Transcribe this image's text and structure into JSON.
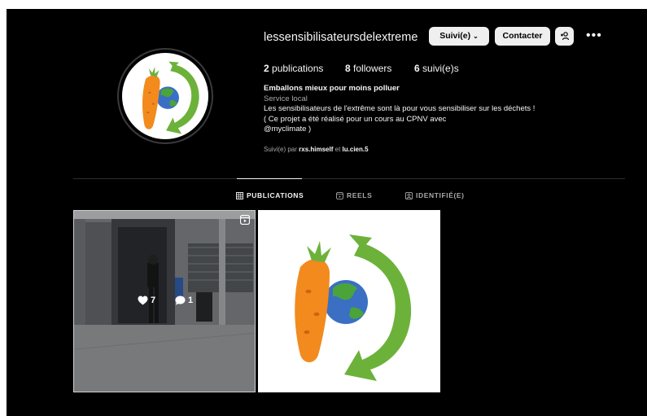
{
  "profile": {
    "username": "lessensibilisateursdelextreme",
    "follow_label": "Suivi(e)",
    "contact_label": "Contacter",
    "stats": {
      "posts_count": "2",
      "posts_label": "publications",
      "followers_count": "8",
      "followers_label": "followers",
      "following_count": "6",
      "following_label": "suivi(e)s"
    },
    "bio": {
      "name": "Emballons mieux pour moins polluer",
      "category": "Service local",
      "line1": "Les sensibilisateurs de l'extrême sont là pour vous sensibiliser sur les déchets !",
      "line2": "( Ce projet a été réalisé pour un cours au CPNV avec",
      "line3": "@myclimate )"
    },
    "followed_by": {
      "prefix": "Suivi(e) par",
      "user1": "rxs.himself",
      "conj": "et",
      "user2": "lu.cien.5"
    }
  },
  "tabs": [
    {
      "label": "PUBLICATIONS",
      "icon": "grid-icon",
      "active": true
    },
    {
      "label": "REELS",
      "icon": "reels-icon",
      "active": false
    },
    {
      "label": "IDENTIFIÉ(E)",
      "icon": "tagged-icon",
      "active": false
    }
  ],
  "posts": [
    {
      "type": "reel",
      "likes": "7",
      "comments": "1"
    },
    {
      "type": "image"
    }
  ],
  "colors": {
    "background": "#000000",
    "text": "#f5f5f5",
    "muted": "#a8a8a8",
    "button": "#efefef",
    "logo_carrot": "#f28a1e",
    "logo_arrow": "#6cb23a",
    "logo_ocean": "#3a6fc4"
  }
}
